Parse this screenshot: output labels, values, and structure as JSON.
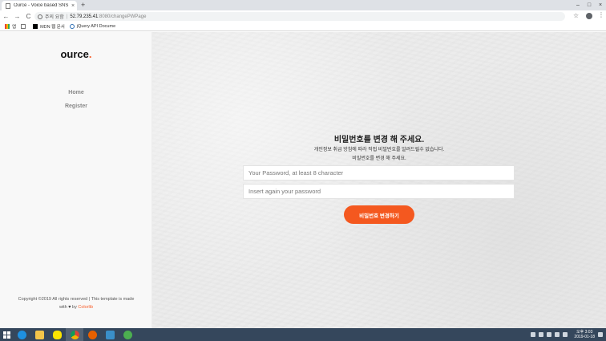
{
  "browser": {
    "tab_title": "Ource - Voice based SNS",
    "tab_close": "×",
    "new_tab": "+",
    "window_controls": [
      "–",
      "□",
      "×"
    ],
    "nav": {
      "back": "←",
      "forward": "→",
      "reload": "C"
    },
    "security_label": "주의 요함",
    "url_host": "52.79.235.41",
    "url_path": ":8080/changePWPage",
    "star": "☆",
    "menu": "⋮",
    "bookmarks": [
      {
        "icon": "apps-icon",
        "label": "앱"
      },
      {
        "icon": "file-icon",
        "label": ""
      },
      {
        "icon": "mdn-icon",
        "label": "MDN 웹 문서"
      },
      {
        "icon": "jquery-icon",
        "label": "jQuery API Docume"
      }
    ]
  },
  "sidebar": {
    "logo_text": "ource",
    "logo_dot": ".",
    "nav": {
      "home": "Home",
      "register": "Register"
    },
    "copyright": {
      "line1": "Copyright ©2019 All rights reserved | This template is made",
      "with": "with",
      "heart": "♥",
      "by": "by",
      "brand": "Colorlib"
    }
  },
  "form": {
    "heading": "비밀번호를 변경 해 주세요.",
    "desc_line1": "개인정보 취급 방침에 따라 직접 비밀번호를 알려드릴수 없습니다.",
    "desc_line2": "비밀번호를 변경 해 주세요.",
    "password_placeholder": "Your Password, at least 8 character",
    "confirm_placeholder": "Insert again your password",
    "submit_label": "비밀번호 변경하기"
  },
  "taskbar": {
    "apps": [
      "ie-icon",
      "file-explorer-icon",
      "kakaotalk-icon",
      "chrome-icon",
      "firefox-icon",
      "tool-icon",
      "app-icon"
    ],
    "clock": {
      "time": "오후 3:03",
      "date": "2019-01-18"
    }
  },
  "colors": {
    "accent": "#f4581f",
    "sidebar_bg": "#f8f8f8",
    "taskbar_bg": "#35475c"
  }
}
